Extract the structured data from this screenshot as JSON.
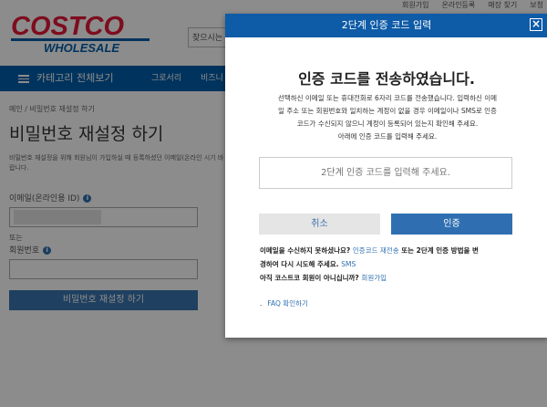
{
  "top_links": [
    "회원가입",
    "온라인등록",
    "매장 찾기",
    "보청"
  ],
  "logo": {
    "line1": "COSTCO",
    "line2": "WHOLESALE",
    "red": "#e31837",
    "blue": "#005daa"
  },
  "search": {
    "placeholder": "찾으시는"
  },
  "nav": {
    "menu_label": "카테고리 전체보기",
    "items": [
      "그로서리",
      "비즈니"
    ]
  },
  "breadcrumb": {
    "home": "메인",
    "current": "비밀번호 재설정 하기",
    "sep": "/"
  },
  "page": {
    "title": "비밀번호 재설정 하기",
    "description": "비밀번호 재설정을 위해 회원님이 가입하실 때 등록하셨던 이메일(온라인 시기 바랍니다.",
    "email_label": "이메일(온라인용 ID)",
    "or_label": "또는",
    "member_label": "회원번호",
    "submit_label": "비밀번호 재설정 하기"
  },
  "modal": {
    "title": "2단계 인증 코드 입력",
    "heading": "인증 코드를 전송하였습니다.",
    "desc_lines": [
      "선택하신 이메일 또는 휴대전화로 6자리 코드를 전송했습니다. 입력하신 이메",
      "일 주소 또는 회원번호와 일치하는 계정이 없을 경우 이메일이나 SMS로 인증",
      "코드가 수신되지 않으니 계정이 등록되어 있는지 확인해 주세요.",
      "아래에 인증 코드를 입력해 주세요."
    ],
    "input_placeholder": "2단계 인증 코드를 입력해 주세요.",
    "cancel_label": "취소",
    "confirm_label": "인증",
    "help_text_1": "이메일을 수신하지 못하셨나요?",
    "resend_link": "인증코드 재전송",
    "help_text_2": "또는 2단계 인증 방법을 변",
    "help_text_3": "경하여 다시 시도해 주세요.",
    "sms_link": "SMS",
    "not_member": "아직 코스트코 회원이 아니십니까?",
    "signup_link": "회원가입",
    "faq_bullet": ".",
    "faq_link": "FAQ 확인하기"
  }
}
